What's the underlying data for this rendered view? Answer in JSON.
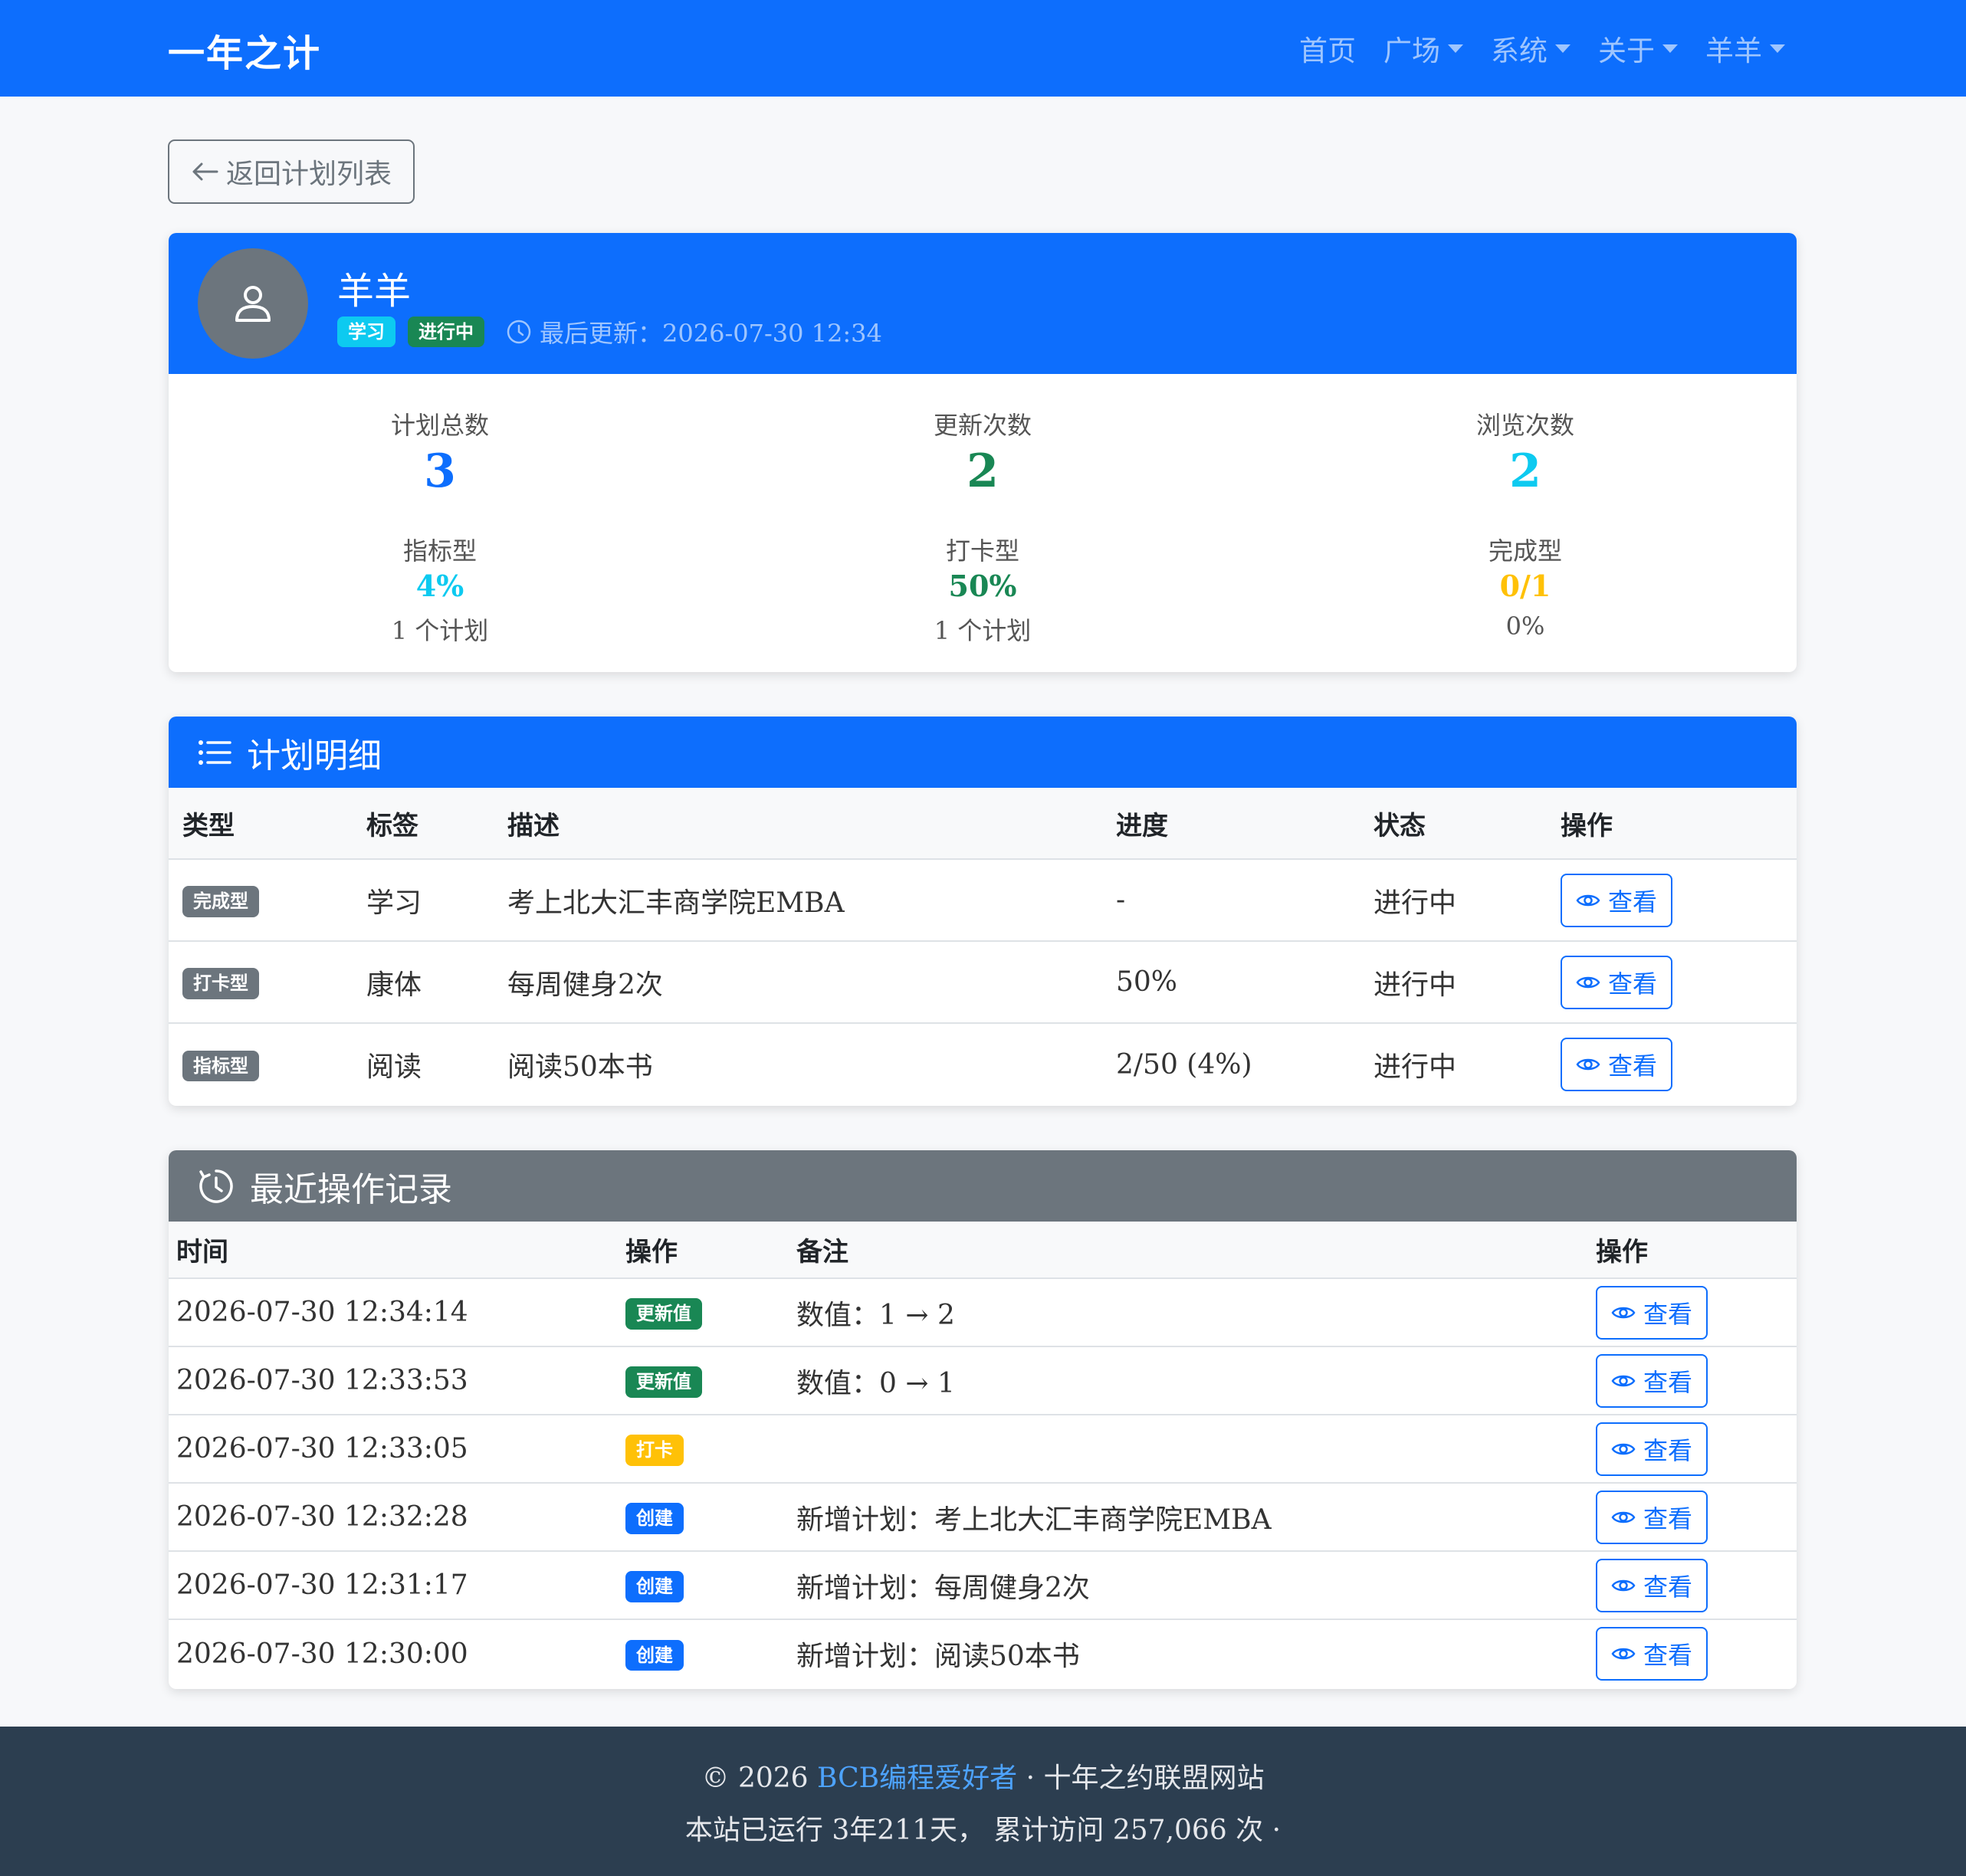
{
  "navbar": {
    "brand": "一年之计",
    "links": [
      {
        "label": "首页",
        "dropdown": false
      },
      {
        "label": "广场",
        "dropdown": true
      },
      {
        "label": "系统",
        "dropdown": true
      },
      {
        "label": "关于",
        "dropdown": true
      },
      {
        "label": "羊羊",
        "dropdown": true
      }
    ]
  },
  "back_button": {
    "icon": "arrow-left-icon",
    "label": "返回计划列表"
  },
  "profile": {
    "name": "羊羊",
    "badges": [
      {
        "label": "学习",
        "color": "#0dcaf0"
      },
      {
        "label": "进行中",
        "color": "#198754"
      }
    ],
    "updated": "最后更新：2026-07-30 12:34"
  },
  "stats": {
    "total": {
      "label": "计划总数",
      "value": "3",
      "color": "#0d6efd"
    },
    "updates": {
      "label": "更新次数",
      "value": "2",
      "color": "#198754"
    },
    "views": {
      "label": "浏览次数",
      "value": "2",
      "color": "#0dcaf0"
    },
    "metric": {
      "label": "指标型",
      "value": "4%",
      "sub": "1 个计划",
      "color": "#0dcaf0"
    },
    "checkin": {
      "label": "打卡型",
      "value": "50%",
      "sub": "1 个计划",
      "color": "#198754"
    },
    "completion": {
      "label": "完成型",
      "value": "0/1",
      "sub": "0%",
      "color": "#ffc107"
    }
  },
  "plans": {
    "title": "计划明细",
    "headers": [
      "类型",
      "标签",
      "描述",
      "进度",
      "状态",
      "操作"
    ],
    "rows": [
      {
        "type": "完成型",
        "tag": "学习",
        "desc": "考上北大汇丰商学院EMBA",
        "progress": "-",
        "status": "进行中",
        "action": "查看"
      },
      {
        "type": "打卡型",
        "tag": "康体",
        "desc": "每周健身2次",
        "progress": "50%",
        "status": "进行中",
        "action": "查看"
      },
      {
        "type": "指标型",
        "tag": "阅读",
        "desc": "阅读50本书",
        "progress": "2/50 (4%)",
        "status": "进行中",
        "action": "查看"
      }
    ]
  },
  "logs": {
    "title": "最近操作记录",
    "headers": [
      "时间",
      "操作",
      "备注",
      "操作"
    ],
    "rows": [
      {
        "time": "2026-07-30 12:34:14",
        "op": "更新值",
        "op_color": "#198754",
        "note": "数值：1 → 2",
        "action": "查看"
      },
      {
        "time": "2026-07-30 12:33:53",
        "op": "更新值",
        "op_color": "#198754",
        "note": "数值：0 → 1",
        "action": "查看"
      },
      {
        "time": "2026-07-30 12:33:05",
        "op": "打卡",
        "op_color": "#ffc107",
        "note": "",
        "action": "查看"
      },
      {
        "time": "2026-07-30 12:32:28",
        "op": "创建",
        "op_color": "#0d6efd",
        "note": "新增计划：考上北大汇丰商学院EMBA",
        "action": "查看"
      },
      {
        "time": "2026-07-30 12:31:17",
        "op": "创建",
        "op_color": "#0d6efd",
        "note": "新增计划：每周健身2次",
        "action": "查看"
      },
      {
        "time": "2026-07-30 12:30:00",
        "op": "创建",
        "op_color": "#0d6efd",
        "note": "新增计划：阅读50本书",
        "action": "查看"
      }
    ]
  },
  "footer": {
    "copyright": "© 2026",
    "author_link": "BCB编程爱好者",
    "site": "· 十年之约联盟网站",
    "runtime": "本站已运行 3年211天， 累计访问 257,066 次 ·"
  }
}
